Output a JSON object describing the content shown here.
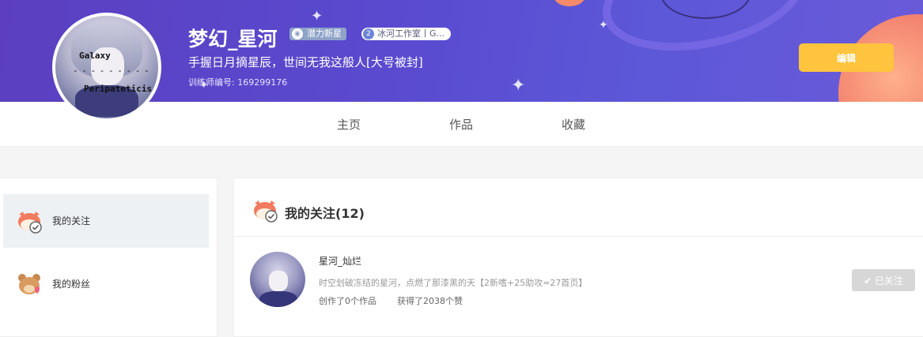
{
  "profile": {
    "username": "梦幻_星河",
    "badge_potential": "潜力新星",
    "badge_studio_num": "2",
    "badge_studio": "冰河工作室丨G...",
    "motto": "手握日月摘星辰，世间无我这般人[大号被封]",
    "trainer_id": "训练师编号: 169299176",
    "avatar_text_line1": "Galaxy",
    "avatar_text_line2": "- - - - - - - - -",
    "avatar_text_line3": "Peripateticis",
    "edit_label": "编辑"
  },
  "nav": {
    "home": "主页",
    "works": "作品",
    "favorites": "收藏"
  },
  "sidebar": {
    "items": [
      {
        "label": "我的关注",
        "icon": "cat-following-icon"
      },
      {
        "label": "我的粉丝",
        "icon": "bear-fans-icon"
      }
    ]
  },
  "main": {
    "title": "我的关注(12)",
    "follows": [
      {
        "name": "星河_灿烂",
        "desc": "时空划破冻结的星河，点燃了那漆黑的天【2新嗜+25助攻=27首页】",
        "works": "创作了0个作品",
        "likes": "获得了2038个赞",
        "button": "✔ 已关注"
      }
    ]
  },
  "colors": {
    "banner": "#5b48cc",
    "edit_button": "#ffc43d",
    "followed_button": "#d7d7d7"
  }
}
